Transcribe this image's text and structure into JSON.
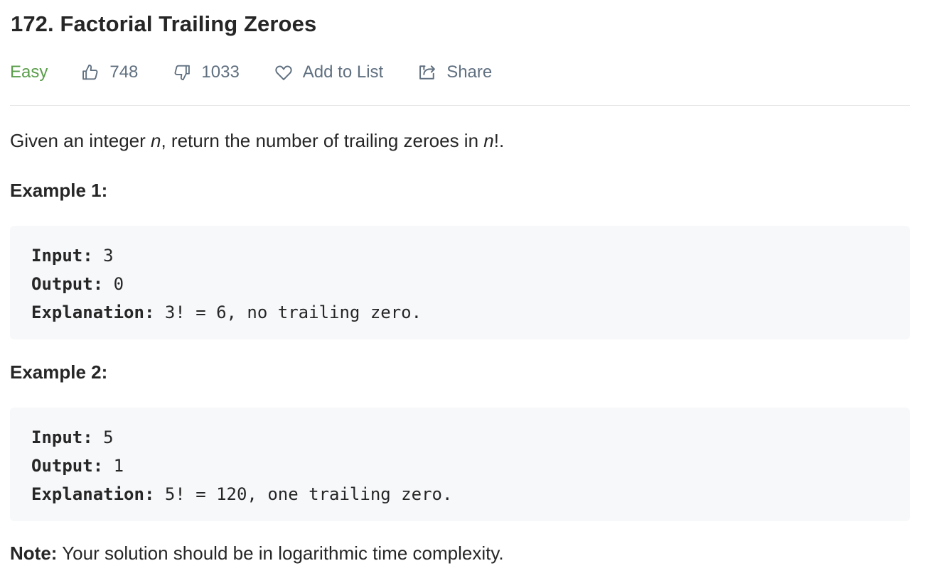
{
  "problem": {
    "title": "172. Factorial Trailing Zeroes",
    "difficulty": "Easy",
    "likes": "748",
    "dislikes": "1033",
    "add_to_list": "Add to List",
    "share": "Share"
  },
  "description": {
    "text_before": "Given an integer ",
    "var1": "n",
    "text_middle": ", return the number of trailing zeroes in ",
    "var2": "n",
    "text_after": "!."
  },
  "examples": [
    {
      "heading": "Example 1:",
      "input_label": "Input:",
      "input_value": " 3",
      "output_label": "Output:",
      "output_value": " 0",
      "explanation_label": "Explanation:",
      "explanation_value": " 3! = 6, no trailing zero."
    },
    {
      "heading": "Example 2:",
      "input_label": "Input:",
      "input_value": " 5",
      "output_label": "Output:",
      "output_value": " 1",
      "explanation_label": "Explanation:",
      "explanation_value": " 5! = 120, one trailing zero."
    }
  ],
  "note": {
    "label": "Note:",
    "text": " Your solution should be in logarithmic time complexity."
  },
  "icons": {
    "like": "thumbs-up-icon",
    "dislike": "thumbs-down-icon",
    "add_to_list": "heart-icon",
    "share": "share-icon"
  },
  "colors": {
    "difficulty_easy": "#5a9e4b",
    "meta_text": "#607080",
    "code_background": "#f7f8fa",
    "text": "#262626"
  }
}
